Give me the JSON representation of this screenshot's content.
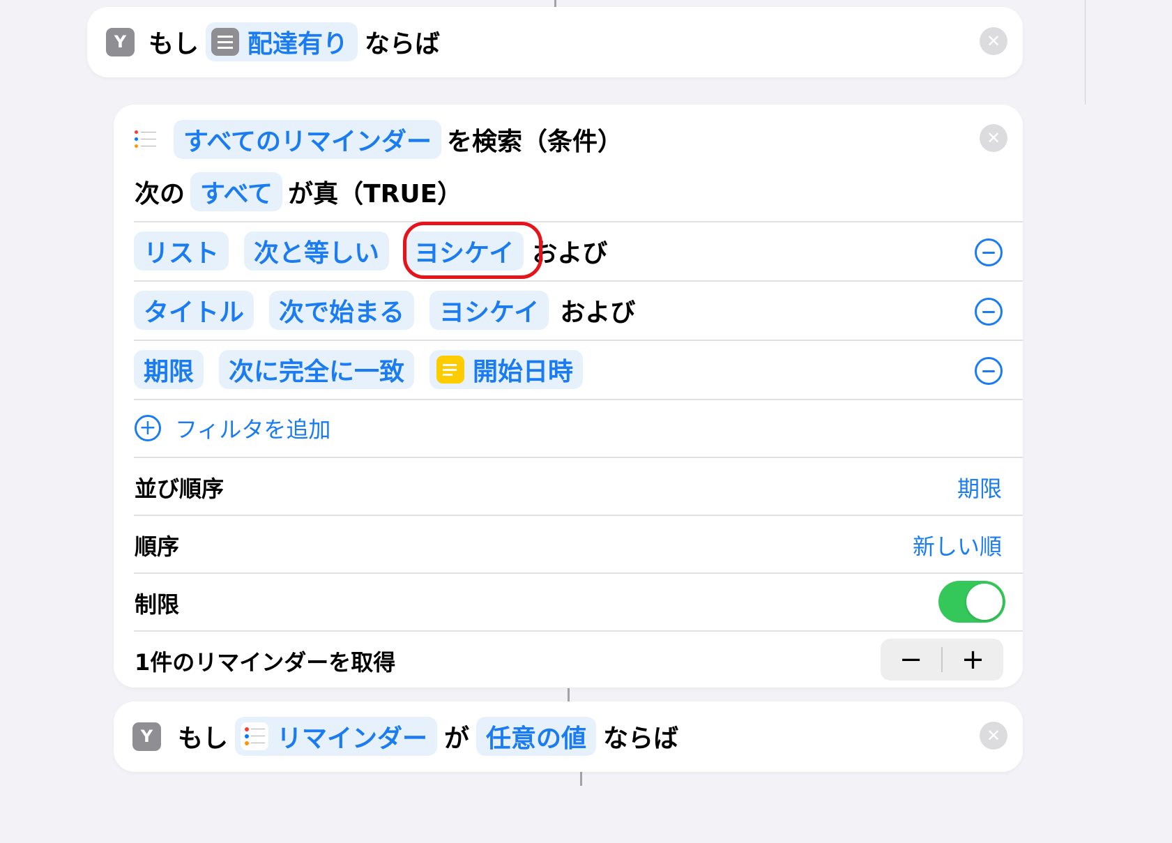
{
  "if_block_1": {
    "keyword": "もし",
    "variable": "配達有り",
    "suffix": "ならば"
  },
  "find_block": {
    "source": "すべてのリマインダー",
    "action_text": "を検索（条件）",
    "prefix": "次の",
    "match_mode": "すべて",
    "match_suffix": "が真（TRUE）",
    "filters": [
      {
        "field": "リスト",
        "operator": "次と等しい",
        "value": "ヨシケイ",
        "conjunction": "および"
      },
      {
        "field": "タイトル",
        "operator": "次で始まる",
        "value": "ヨシケイ",
        "conjunction": "および"
      },
      {
        "field": "期限",
        "operator": "次に完全に一致",
        "value": "開始日時",
        "conjunction": ""
      }
    ],
    "add_filter_label": "フィルタを追加",
    "sort_label": "並び順序",
    "sort_value": "期限",
    "order_label": "順序",
    "order_value": "新しい順",
    "limit_label": "制限",
    "limit_enabled": true,
    "count_label": "1件のリマインダーを取得",
    "stepper_minus": "−",
    "stepper_plus": "+"
  },
  "if_block_2": {
    "keyword": "もし",
    "variable": "リマインダー",
    "connector": "が",
    "condition": "任意の値",
    "suffix": "ならば"
  },
  "colors": {
    "accent": "#1a7cf0",
    "pill_bg": "#e7f1fc",
    "toggle_on": "#34c759",
    "highlight": "#e5131a",
    "background": "#f2f2f7"
  }
}
